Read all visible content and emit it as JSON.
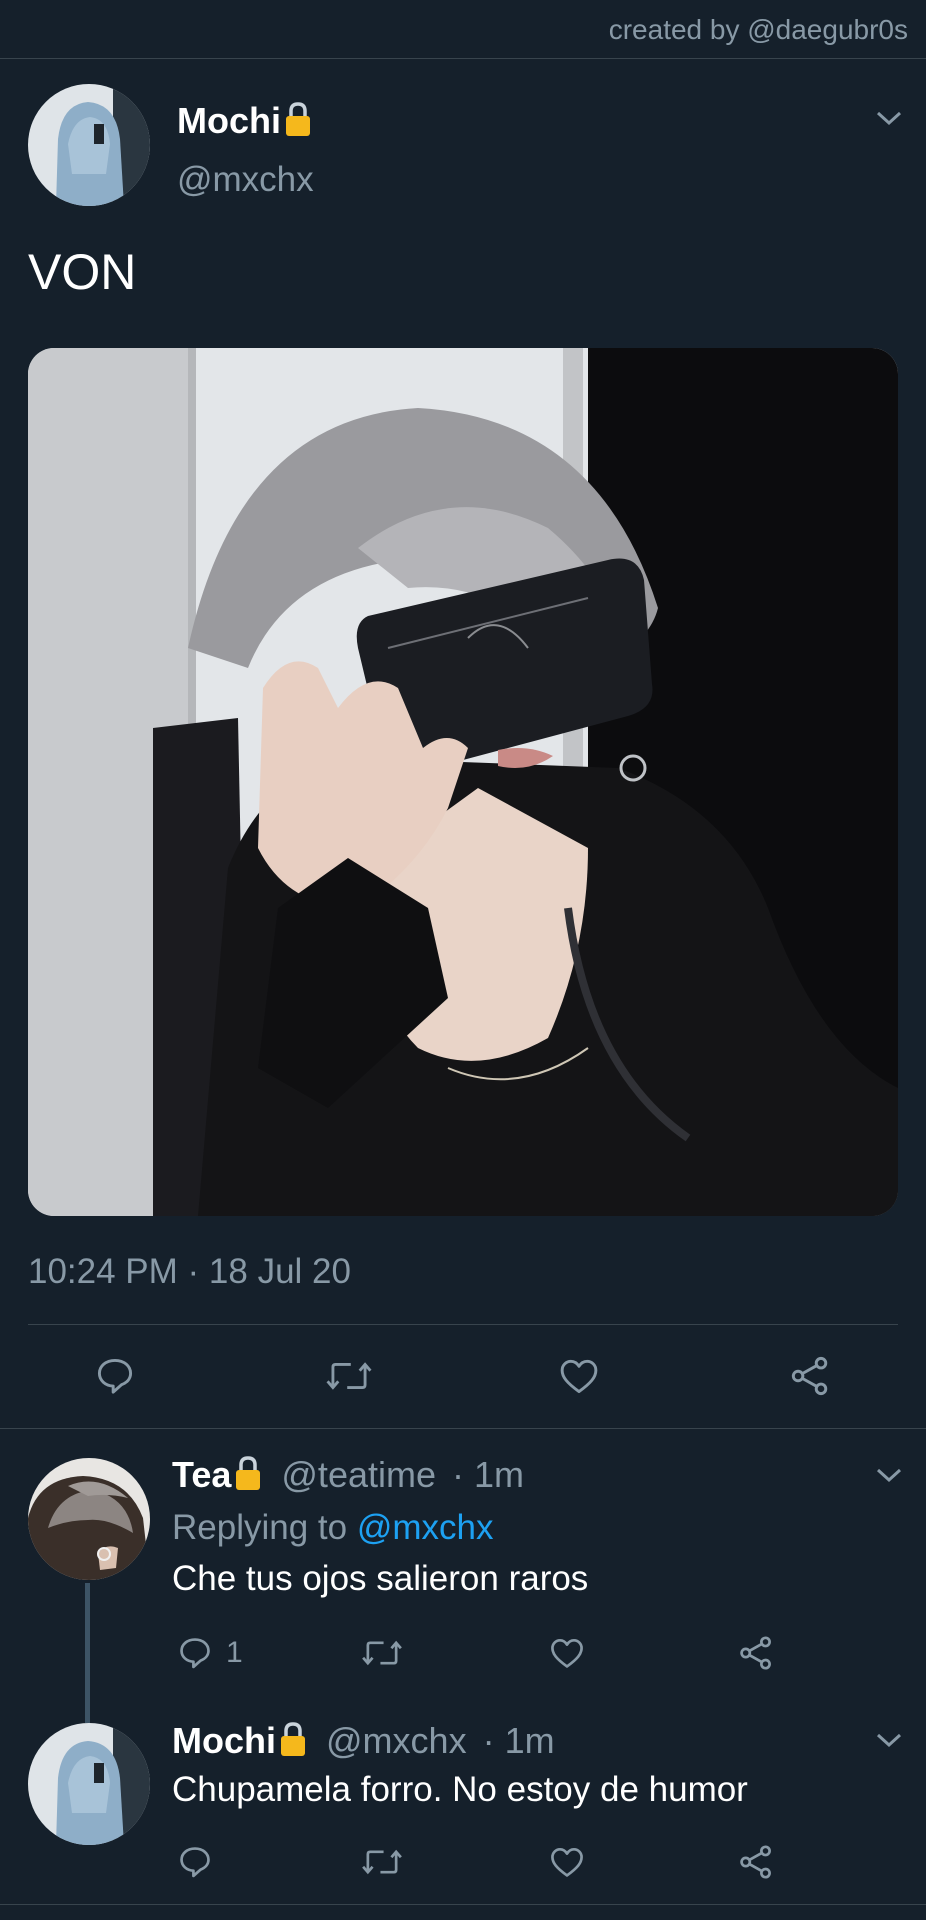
{
  "credit": "created by @daegubr0s",
  "main_tweet": {
    "display_name": "Mochi",
    "handle": "@mxchx",
    "text": "VON",
    "timestamp": "10:24 PM · 18 Jul 20",
    "lock_icon": "lock-icon"
  },
  "actions": {
    "icons": [
      "reply-icon",
      "retweet-icon",
      "like-icon",
      "share-icon"
    ]
  },
  "replies": [
    {
      "display_name": "Tea",
      "handle": "@teatime",
      "time": "· 1m",
      "replying_to_label": "Replying to",
      "replying_to_handle": "@mxchx",
      "text": "Che tus ojos salieron raros",
      "reply_count": "1"
    },
    {
      "display_name": "Mochi",
      "handle": "@mxchx",
      "time": "· 1m",
      "text": "Chupamela forro. No estoy de humor"
    }
  ],
  "colors": {
    "background": "#15202b",
    "muted_text": "#8899a6",
    "accent_blue": "#1da1f2",
    "divider": "#38444d",
    "lock_gold": "#f5b81c"
  }
}
